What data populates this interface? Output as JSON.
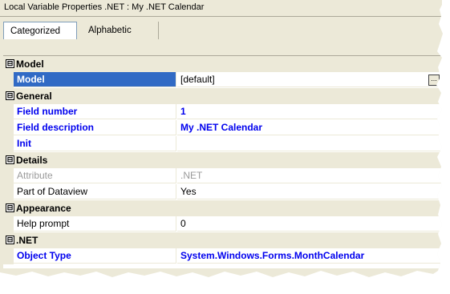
{
  "window": {
    "title": "Local Variable Properties .NET : My .NET Calendar"
  },
  "tabs": [
    {
      "label": "Categorized",
      "active": true
    },
    {
      "label": "Alphabetic",
      "active": false
    }
  ],
  "grid": {
    "categories": [
      {
        "name": "Model",
        "expanded": true
      },
      {
        "name": "General",
        "expanded": true
      },
      {
        "name": "Details",
        "expanded": true
      },
      {
        "name": "Appearance",
        "expanded": true
      },
      {
        "name": ".NET",
        "expanded": true
      }
    ],
    "properties": {
      "model": {
        "name": "Model",
        "value": "[default]",
        "selected": true,
        "has_ellipsis": true
      },
      "field_number": {
        "name": "Field number",
        "value": "1"
      },
      "field_description": {
        "name": "Field description",
        "value": "My .NET Calendar"
      },
      "init": {
        "name": "Init",
        "value": ""
      },
      "attribute": {
        "name": "Attribute",
        "value": ".NET",
        "disabled": true
      },
      "part_of_dataview": {
        "name": "Part of Dataview",
        "value": "Yes"
      },
      "help_prompt": {
        "name": "Help prompt",
        "value": "0"
      },
      "object_type": {
        "name": "Object Type",
        "value": "System.Windows.Forms.MonthCalendar"
      }
    },
    "expander_glyph": "⊟",
    "ellipsis_glyph": "..."
  },
  "colors": {
    "selection": "#316ac5",
    "bold_value": "#0000ee",
    "category_bg": "#ece9d8",
    "disabled_text": "#9a9a9a"
  }
}
